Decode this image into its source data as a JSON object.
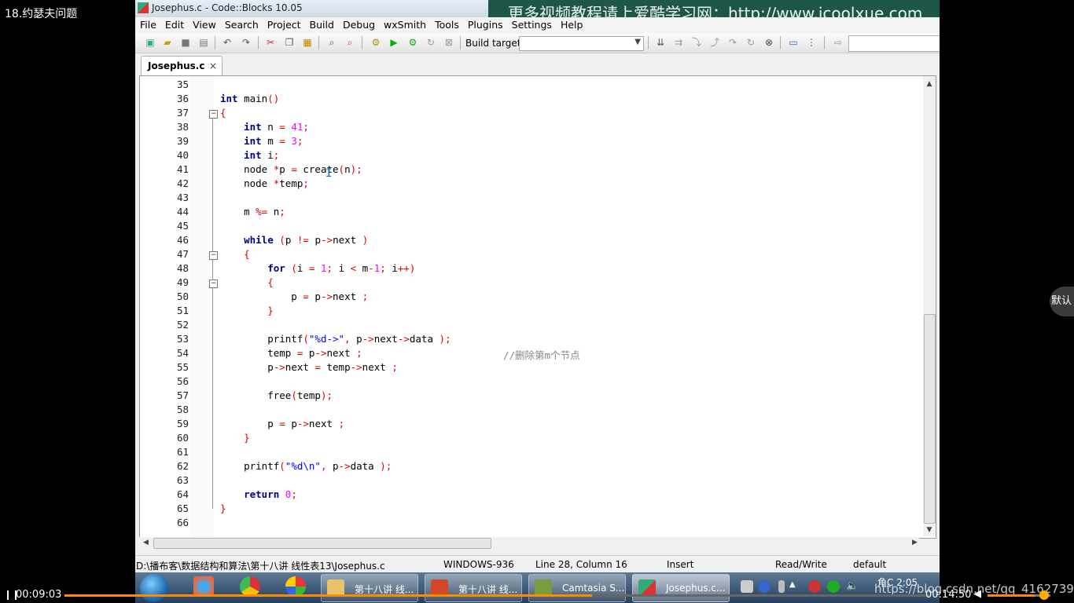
{
  "video": {
    "title": "18.约瑟夫问题",
    "current_time": "00:09:03",
    "total_time": "00:14:50",
    "progress": 0.61,
    "volume": 0.75,
    "side_badge": "默认"
  },
  "window": {
    "title": "Josephus.c - Code::Blocks 10.05",
    "watermark": "更多视频教程请上爱酷学习网：http://www.icoolxue.com"
  },
  "menu": [
    "File",
    "Edit",
    "View",
    "Search",
    "Project",
    "Build",
    "Debug",
    "wxSmith",
    "Tools",
    "Plugins",
    "Settings",
    "Help"
  ],
  "toolbar": {
    "build_target_label": "Build target:",
    "build_target_value": ""
  },
  "tab": {
    "label": "Josephus.c",
    "close": "×"
  },
  "editor": {
    "lines": [
      35,
      36,
      37,
      38,
      39,
      40,
      41,
      42,
      43,
      44,
      45,
      46,
      47,
      48,
      49,
      50,
      51,
      52,
      53,
      54,
      55,
      56,
      57,
      58,
      59,
      60,
      61,
      62,
      63,
      64,
      65,
      66
    ],
    "code": [
      "",
      "int main()",
      "{",
      "    int n = 41;",
      "    int m = 3;",
      "    int i;",
      "    node *p = create(n);",
      "    node *temp;",
      "",
      "    m %= n;",
      "",
      "    while (p != p->next )",
      "    {",
      "        for (i = 1; i < m-1; i++)",
      "        {",
      "            p = p->next ;",
      "        }",
      "",
      "        printf(\"%d->\", p->next->data );",
      "        temp = p->next ;",
      "        p->next = temp->next ;",
      "",
      "        free(temp);",
      "",
      "        p = p->next ;",
      "    }",
      "",
      "    printf(\"%d\\n\", p->data );",
      "",
      "    return 0;",
      "}",
      ""
    ],
    "comment_line_54": "//删除第m个节点"
  },
  "status": {
    "path": "D:\\播布客\\数据结构和算法\\第十八讲 线性表13\\Josephus.c",
    "encoding": "WINDOWS-936",
    "position": "Line 28, Column 16",
    "mode": "Insert",
    "access": "Read/Write",
    "profile": "default"
  },
  "taskbar": {
    "buttons": [
      "第十八讲 线...",
      "第十八讲 线...",
      "Camtasia S...",
      "Josephus.c..."
    ],
    "clock": "角C 2:05"
  },
  "blog_watermark": "https://blog.csdn.net/qq_41627390",
  "colors": {
    "keyword": "#00008b",
    "number": "#ff00ff",
    "operator": "#dd0000",
    "string": "#0000ff",
    "comment": "#888888",
    "accent": "#ff8a00"
  }
}
